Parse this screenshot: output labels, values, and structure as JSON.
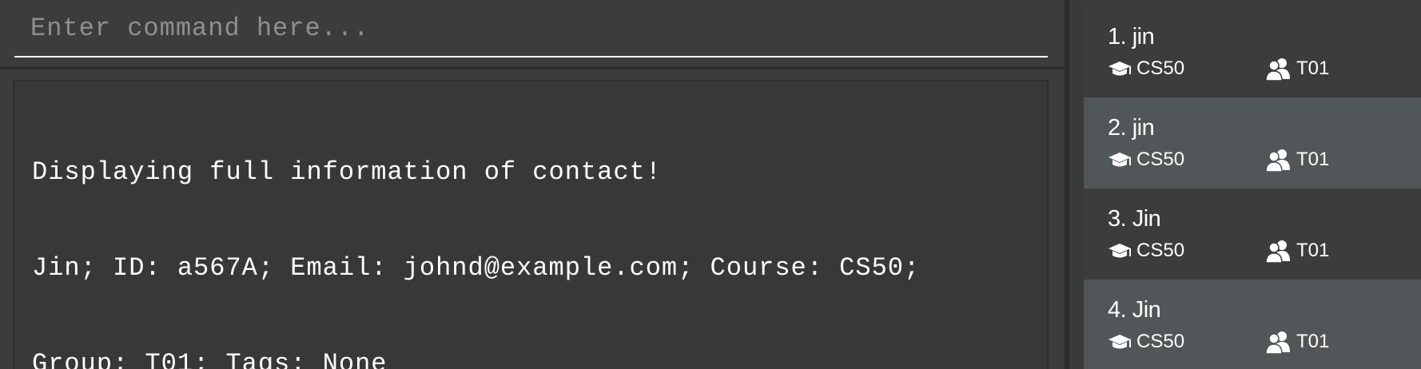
{
  "command": {
    "placeholder": "Enter command here...",
    "value": ""
  },
  "result": {
    "lines": [
      "Displaying full information of contact!",
      "Jin; ID: a567A; Email: johnd@example.com; Course: CS50;",
      "Group: T01; Tags: None"
    ]
  },
  "persons": [
    {
      "name": "1. jin",
      "course": "CS50",
      "group": "T01"
    },
    {
      "name": "2. jin",
      "course": "CS50",
      "group": "T01"
    },
    {
      "name": "3. Jin",
      "course": "CS50",
      "group": "T01"
    },
    {
      "name": "4. Jin",
      "course": "CS50",
      "group": "T01"
    }
  ],
  "icons": {
    "course": "graduation-cap-icon",
    "group": "group-people-icon"
  },
  "colors": {
    "background": "#3c3c3c",
    "card_alt": "#515658",
    "text": "#ffffff",
    "placeholder": "#8f8f8f"
  }
}
